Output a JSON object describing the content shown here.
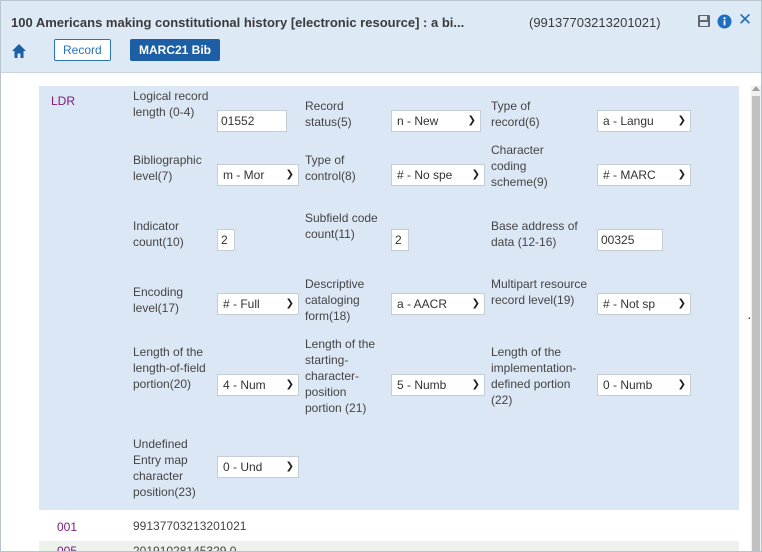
{
  "header": {
    "title": "100 Americans making constitutional history [electronic resource] : a bi...",
    "mms_id": "(99137703213201021)",
    "tabs": {
      "record": "Record",
      "marc": "MARC21 Bib"
    }
  },
  "icons": [
    "home-icon",
    "save-icon",
    "info-icon",
    "close-icon",
    "chevron-down-icon",
    "more-icon"
  ],
  "colors": {
    "header_bg": "#ddeaf6",
    "panel_bg": "#dbe7f5",
    "accent": "#1c5fa5",
    "tag": "#7a1a7a"
  },
  "ldr": {
    "tag": "LDR",
    "more_label": "···",
    "fields": {
      "record_length": {
        "label": "Logical record length (0-4)",
        "value": "01552"
      },
      "record_status": {
        "label": "Record status(5)",
        "value": "n - New"
      },
      "type_of_record": {
        "label": "Type of record(6)",
        "value": "a - Langu"
      },
      "bib_level": {
        "label": "Bibliographic level(7)",
        "value": "m - Mor"
      },
      "type_of_control": {
        "label": "Type of control(8)",
        "value": "# - No spe"
      },
      "char_coding": {
        "label": "Character coding scheme(9)",
        "value": "# - MARC"
      },
      "indicator_count": {
        "label": "Indicator count(10)",
        "value": "2"
      },
      "subfield_code_count": {
        "label": "Subfield code count(11)",
        "value": "2"
      },
      "base_address": {
        "label": "Base address of data (12-16)",
        "value": "00325"
      },
      "encoding_level": {
        "label": "Encoding level(17)",
        "value": "# - Full"
      },
      "desc_cataloging": {
        "label": "Descriptive cataloging form(18)",
        "value": "a - AACR"
      },
      "multipart": {
        "label": "Multipart resource record level(19)",
        "value": "# - Not sp"
      },
      "length_of_field": {
        "label": "Length of the length-of-field portion(20)",
        "value": "4 - Num"
      },
      "length_start_char": {
        "label": "Length of the starting-character-position portion (21)",
        "value": "5 - Numb"
      },
      "length_impl": {
        "label": "Length of the implementation-defined portion (22)",
        "value": "0 - Numb"
      },
      "undefined_entry": {
        "label": "Undefined Entry map character position(23)",
        "value": "0 - Und"
      }
    }
  },
  "rows": [
    {
      "tag": "001",
      "value": "99137703213201021"
    },
    {
      "tag": "005",
      "value": "20191028145329.0"
    }
  ]
}
